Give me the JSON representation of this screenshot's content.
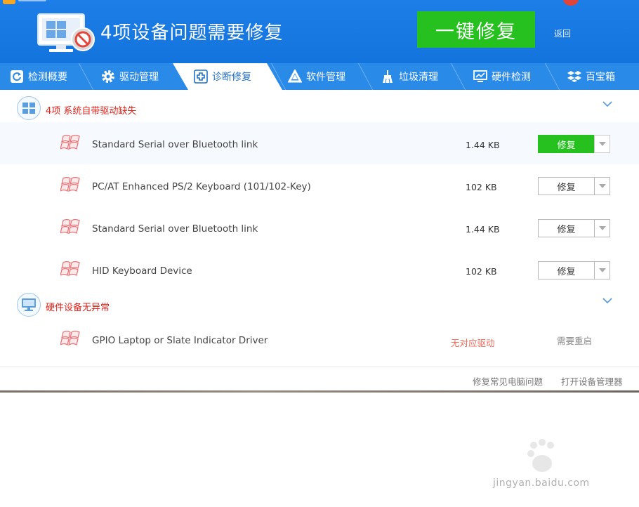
{
  "header": {
    "title": "4项设备问题需要修复",
    "fix_all_label": "一键修复",
    "back_label": "返回"
  },
  "tabs": [
    {
      "label": "检测概要",
      "icon": "refresh-icon"
    },
    {
      "label": "驱动管理",
      "icon": "gear-icon"
    },
    {
      "label": "诊断修复",
      "icon": "medical-cross-icon",
      "active": true
    },
    {
      "label": "软件管理",
      "icon": "triangle-logo-icon"
    },
    {
      "label": "垃圾清理",
      "icon": "broom-icon"
    },
    {
      "label": "硬件检测",
      "icon": "monitor-chart-icon"
    },
    {
      "label": "百宝箱",
      "icon": "toolbox-icon"
    }
  ],
  "sections": [
    {
      "title": "4项 系统自带驱动缺失",
      "icon": "windows-logo-icon",
      "rows": [
        {
          "name": "Standard Serial over Bluetooth link",
          "size": "1.44 KB",
          "action": "修复",
          "primary": true
        },
        {
          "name": "PC/AT Enhanced PS/2 Keyboard (101/102-Key)",
          "size": "102 KB",
          "action": "修复"
        },
        {
          "name": "Standard Serial over Bluetooth link",
          "size": "1.44 KB",
          "action": "修复"
        },
        {
          "name": "HID Keyboard Device",
          "size": "102 KB",
          "action": "修复"
        }
      ]
    },
    {
      "title": "硬件设备无异常",
      "icon": "monitor-icon",
      "rows": [
        {
          "name": "GPIO Laptop or Slate Indicator Driver",
          "status": "无对应驱动",
          "action_text": "需要重启"
        }
      ]
    }
  ],
  "footer": {
    "link1": "修复常见电脑问题",
    "link2": "打开设备管理器"
  },
  "watermark": {
    "text": "jingyan.baidu.com"
  },
  "colors": {
    "header_blue": "#1474de",
    "tab_blue": "#2a8ae8",
    "primary_green": "#27c11f",
    "alert_red": "#d9241c",
    "status_red": "#ee6a5a"
  }
}
